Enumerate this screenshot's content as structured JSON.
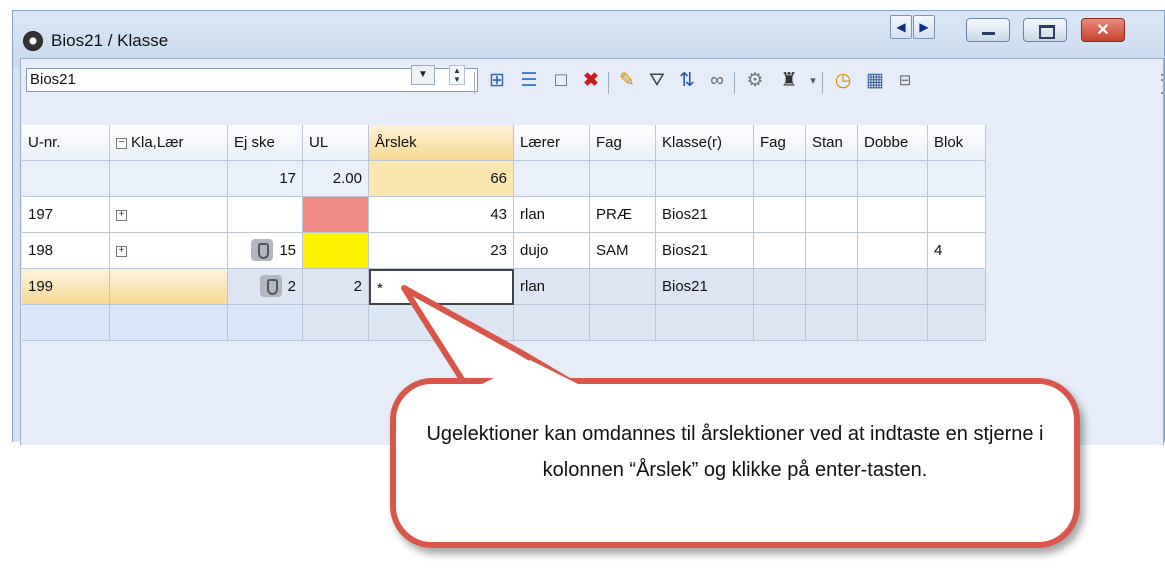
{
  "window": {
    "title": "Bios21 / Klasse",
    "nav_prev": "◀",
    "nav_next": "▶",
    "close_glyph": "✕"
  },
  "toolbar": {
    "class_select_value": "Bios21",
    "icons": [
      "expand-grid-icon",
      "list-icon",
      "new-icon",
      "delete-icon",
      "edit-icon",
      "filter-icon",
      "sort-icon",
      "link-icon",
      "tools-icon",
      "graduation-icon",
      "clock-icon",
      "calendar-icon",
      "grid-small-icon"
    ]
  },
  "table": {
    "headers": [
      "U-nr.",
      "Kla,Lær",
      "Ej ske",
      "UL",
      "Årslek",
      "Lærer",
      "Fag",
      "Klasse(r)",
      "Fag",
      "Stan",
      "Dobbe",
      "Blok"
    ],
    "sum_row": {
      "ej_skem": "17",
      "ul": "2.00",
      "arslek": "66"
    },
    "rows": [
      {
        "unr": "197",
        "ej": "",
        "ul": "",
        "arslek": "43",
        "laerer": "rlan",
        "fag": "PRÆ",
        "klasser": "Bios21",
        "blok": ""
      },
      {
        "unr": "198",
        "ej": "15",
        "ul": "",
        "arslek": "23",
        "laerer": "dujo",
        "fag": "SAM",
        "klasser": "Bios21",
        "blok": "4"
      },
      {
        "unr": "199",
        "ej": "2",
        "ul": "2",
        "arslek": "*",
        "laerer": "rlan",
        "fag": "",
        "klasser": "Bios21",
        "blok": ""
      }
    ]
  },
  "callout": {
    "text": "Ugelektioner kan omdannes til årslektioner ved at indtaste en stjerne i kolonnen “Årslek” og klikke på enter-tasten."
  },
  "colors": {
    "callout_border": "#d9574a",
    "selected_header": "#f9d993",
    "pink_cell": "#ef8a84",
    "yellow_cell": "#fff200"
  }
}
